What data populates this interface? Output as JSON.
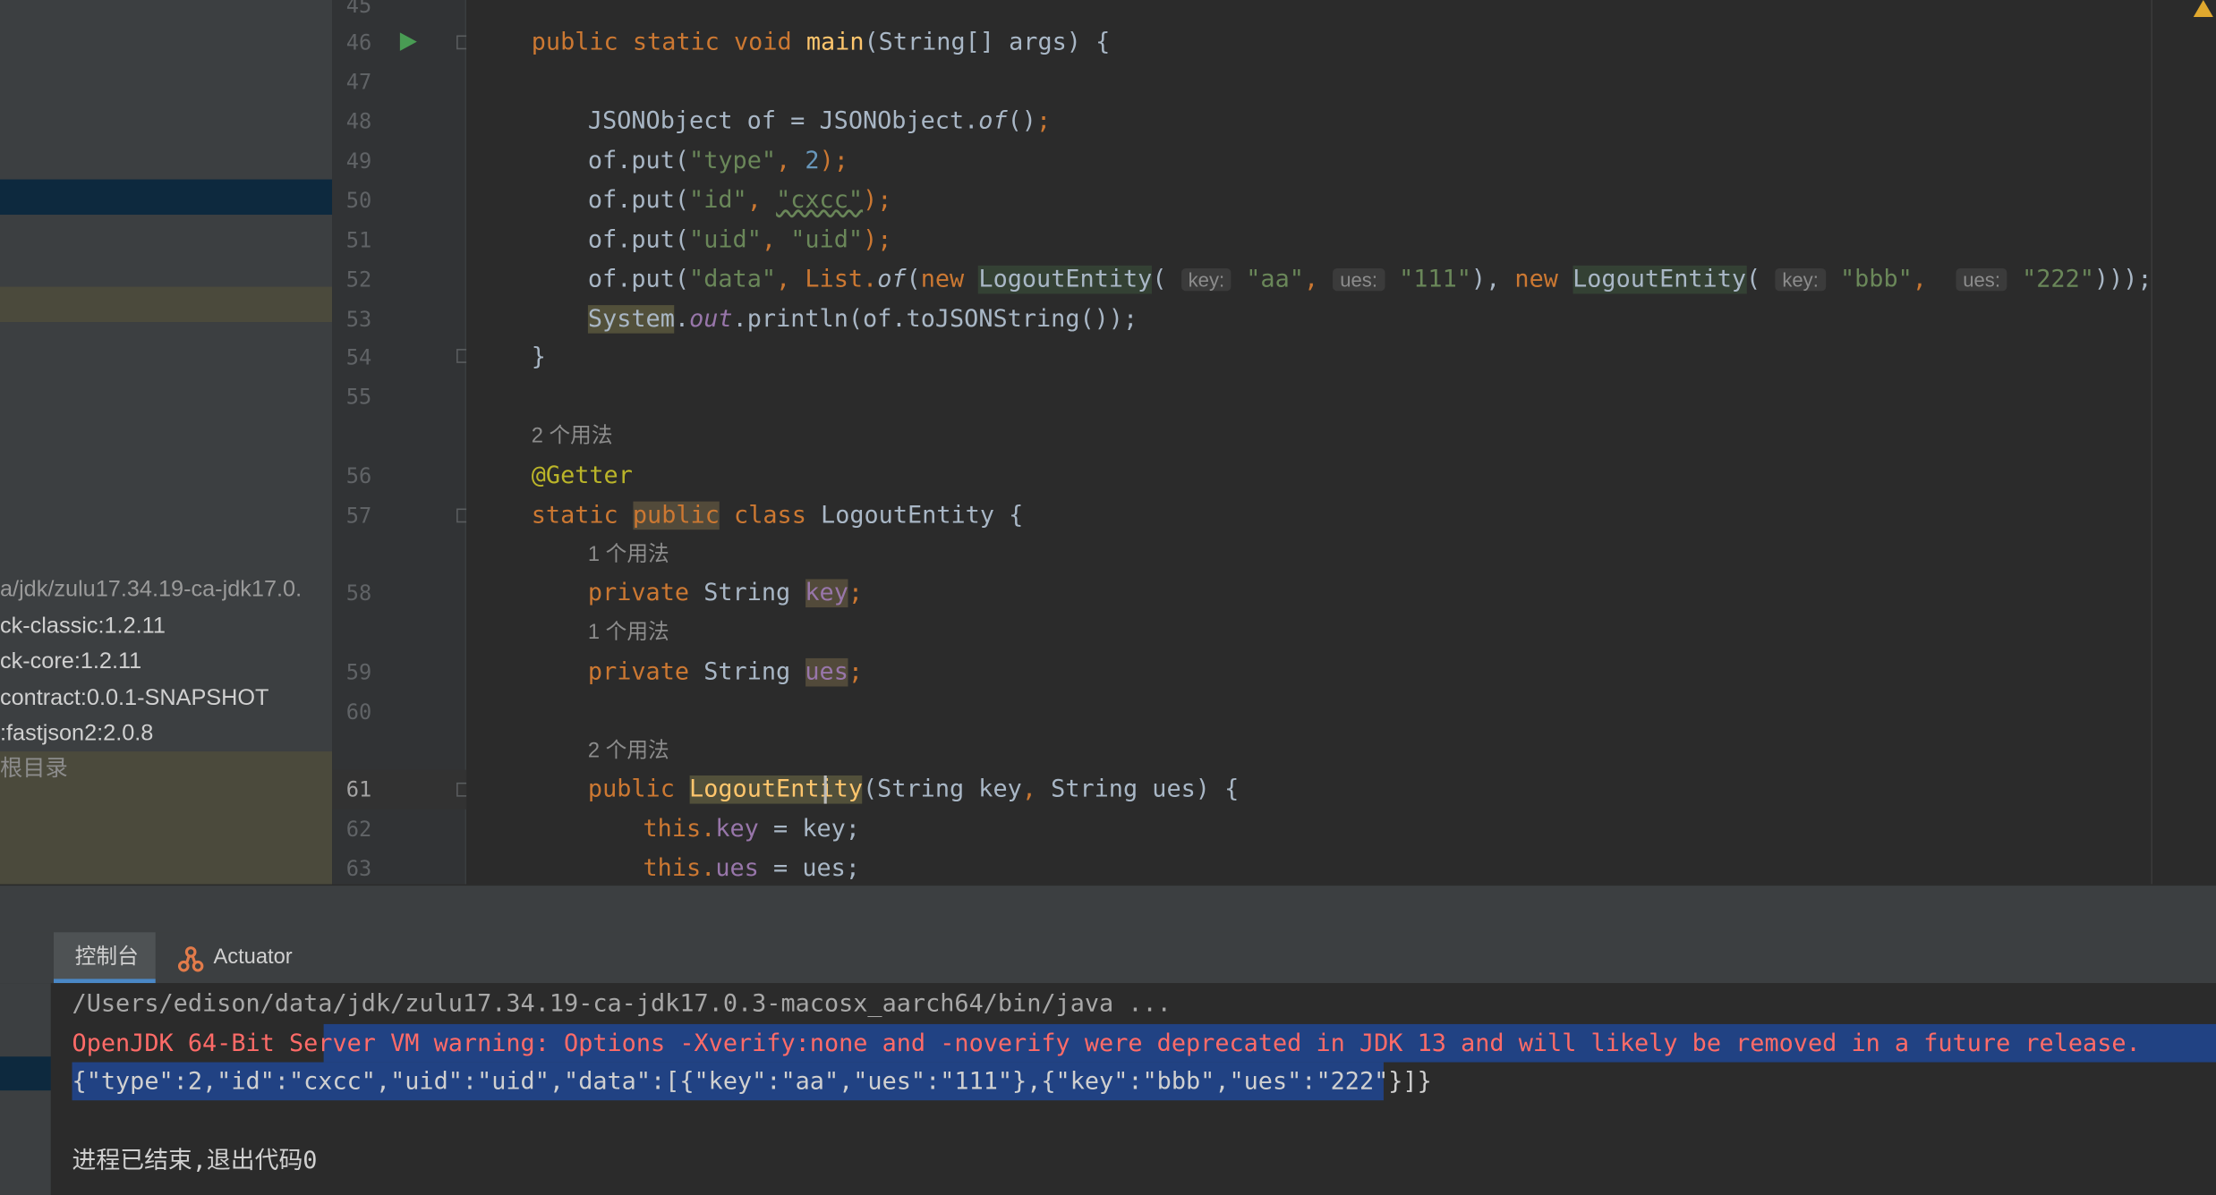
{
  "project_panel": {
    "items": [
      {
        "label": "a/jdk/zulu17.34.19-ca-jdk17.0."
      },
      {
        "label": "ck-classic:1.2.11"
      },
      {
        "label": "ck-core:1.2.11"
      },
      {
        "label": "contract:0.0.1-SNAPSHOT"
      },
      {
        "label": ":fastjson2:2.0.8"
      },
      {
        "label": "根目录"
      }
    ]
  },
  "gutter": {
    "line_numbers": [
      "45",
      "46",
      "47",
      "48",
      "49",
      "50",
      "51",
      "52",
      "53",
      "54",
      "55",
      "56",
      "57",
      "58",
      "59",
      "60",
      "61",
      "62",
      "63"
    ]
  },
  "editor": {
    "l46": {
      "a": "public static void ",
      "b": "main",
      "c": "(String[] args) {"
    },
    "l48": {
      "a": "JSONObject of = JSONObject.",
      "b": "of",
      "c": "()",
      ";": ";"
    },
    "l49": {
      "a": "of.put(",
      "s": "\"type\"",
      "c": ", ",
      "n": "2",
      "d": ");"
    },
    "l50": {
      "a": "of.put(",
      "s": "\"id\"",
      "c": ", ",
      "s2": "\"cxcc\"",
      "d": ");"
    },
    "l51": {
      "a": "of.put(",
      "s": "\"uid\"",
      "c": ", ",
      "s2": "\"uid\"",
      "d": ");"
    },
    "l52": {
      "a": "of.put(",
      "s": "\"data\"",
      "c": ", List.",
      "of": "of",
      "p": "(",
      "new1": "new ",
      "cls1": "LogoutEntity",
      "p1": "(",
      "h1": "key:",
      "v1": "\"aa\"",
      "cm1": ",",
      "h2": "ues:",
      "v2": "\"111\"",
      "cl1": "), ",
      "new2": "new ",
      "cls2": "LogoutEntity",
      "p2": "(",
      "h3": "key:",
      "v3": "\"bbb\"",
      "cm2": ",",
      "h4": "ues:",
      "v4": "\"222\"",
      "end": ")));"
    },
    "l53": {
      "sys": "System",
      "dot": ".",
      "out": "out",
      "rest": ".println(of.toJSONString());"
    },
    "l54": {
      "a": "}"
    },
    "u56": "2 个用法",
    "l56": {
      "a": "@Getter"
    },
    "l57": {
      "a": "static ",
      "pub": "public",
      "b": " class ",
      "c": "LogoutEntity {"
    },
    "u58": "1 个用法",
    "l58": {
      "a": "private ",
      "b": "String ",
      "f": "key",
      ";": ";"
    },
    "u59": "1 个用法",
    "l59": {
      "a": "private ",
      "b": "String ",
      "f": "ues",
      ";": ";"
    },
    "u61": "2 个用法",
    "l61": {
      "a": "public ",
      "fn": "LogoutEntity",
      "c": "(String key",
      ",": ", ",
      "d": "String ues) {"
    },
    "l62": {
      "a": "this.",
      "f": "key",
      "c": " = key;"
    },
    "l63": {
      "a": "this.",
      "f": "ues",
      "c": " = ues;"
    }
  },
  "console": {
    "tabs": [
      {
        "label": "控制台"
      },
      {
        "label": "Actuator"
      }
    ],
    "lines": [
      "/Users/edison/data/jdk/zulu17.34.19-ca-jdk17.0.3-macosx_aarch64/bin/java ...",
      "OpenJDK 64-Bit Server VM warning: Options -Xverify:none and -noverify were deprecated in JDK 13 and will likely be removed in a future release.",
      "{\"type\":2,\"id\":\"cxcc\",\"uid\":\"uid\",\"data\":[{\"key\":\"aa\",\"ues\":\"111\"},{\"key\":\"bbb\",\"ues\":\"222\"}]}",
      "进程已结束,退出代码0"
    ]
  },
  "colors": {
    "keyword": "#cc7832",
    "string": "#6a8759",
    "number": "#6897bb",
    "function": "#ffc66d",
    "annotation": "#bbb529",
    "field": "#9876aa",
    "error": "#ff6b68",
    "selection": "#214283"
  },
  "icons": {
    "run": "run-gutter-icon",
    "actuator": "actuator-icon",
    "warning": "warning-icon"
  }
}
